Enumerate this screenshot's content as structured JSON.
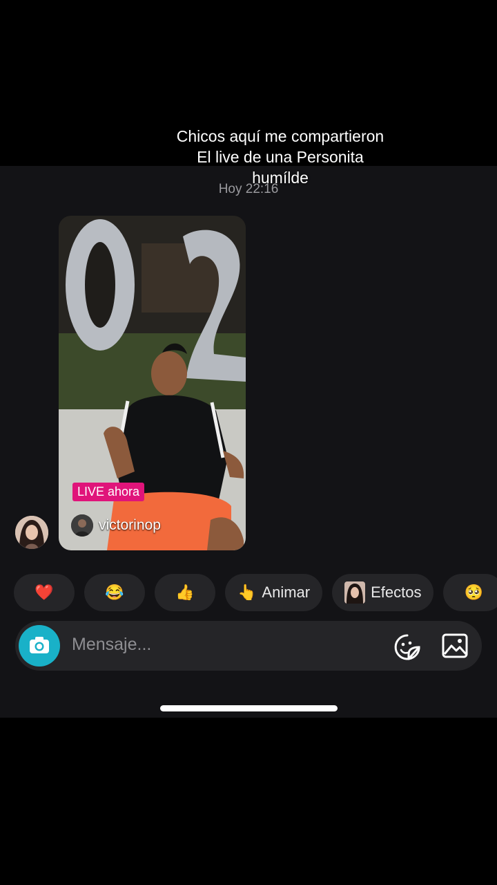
{
  "caption": {
    "line1": "Chicos  aquí me compartieron",
    "line2": "El live de una Personita",
    "line3": "humílde"
  },
  "chat": {
    "timestamp": "Hoy 22:16"
  },
  "shared_live": {
    "badge": "LIVE ahora",
    "username": "victorinop"
  },
  "reactions": [
    {
      "icon": "heart-icon",
      "glyph": "❤️"
    },
    {
      "icon": "laughing-icon",
      "glyph": "😂"
    },
    {
      "icon": "thumbs-up-icon",
      "glyph": "👍"
    },
    {
      "icon": "pointing-hand-icon",
      "glyph": "👆",
      "label": "Animar"
    },
    {
      "icon": "effects-icon",
      "label": "Efectos"
    },
    {
      "icon": "emoji-face-icon",
      "glyph": "🥺"
    }
  ],
  "composer": {
    "placeholder": "Mensaje..."
  },
  "colors": {
    "chat_background": "#131316",
    "live_badge": "#e0147a",
    "camera_button": "#19b1c8",
    "chip_background": "#252528"
  }
}
